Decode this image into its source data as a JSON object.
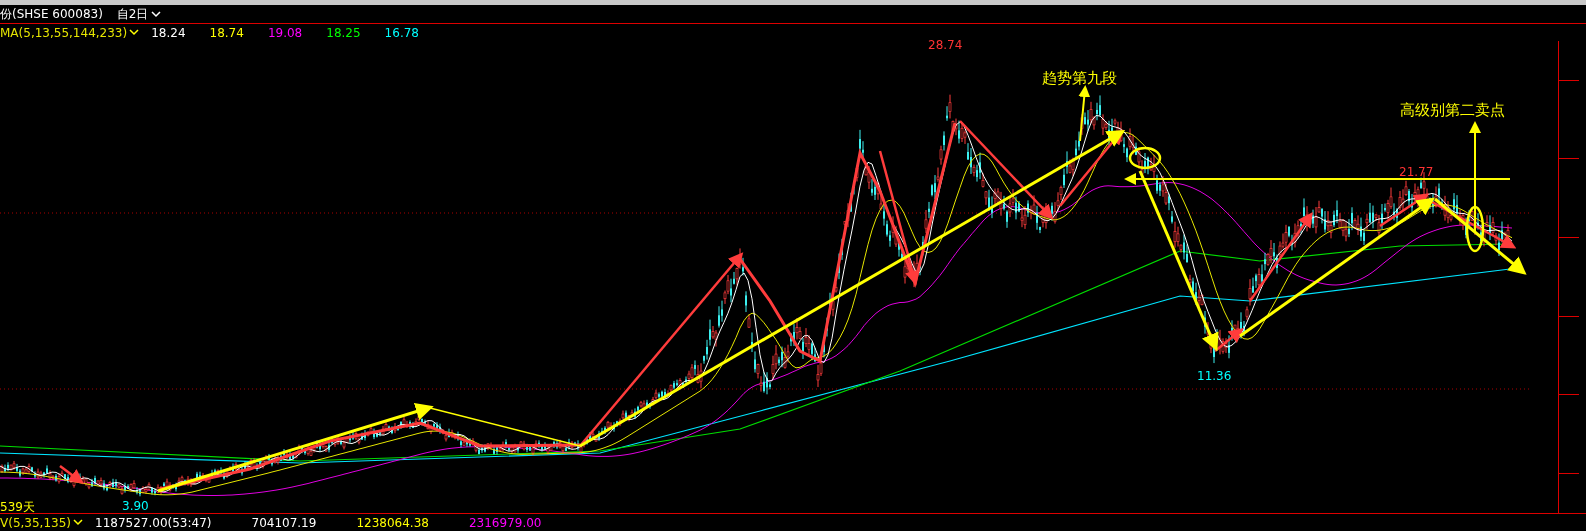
{
  "header": {
    "title": "份(SHSE 600083)",
    "period": "自2日"
  },
  "ma_legend": {
    "label": "MA(5,13,55,144,233)",
    "values": [
      {
        "value": "18.24",
        "color": "#ffffff"
      },
      {
        "value": "18.74",
        "color": "#ffff00"
      },
      {
        "value": "19.08",
        "color": "#ff00ff"
      },
      {
        "value": "18.25",
        "color": "#00ff00"
      },
      {
        "value": "16.78",
        "color": "#00ffff"
      }
    ]
  },
  "chart_labels": [
    {
      "kind": "price",
      "text": "28.74",
      "color": "#ff3333"
    },
    {
      "kind": "price",
      "text": "21.77",
      "color": "#ff3333"
    },
    {
      "kind": "price",
      "text": "11.36",
      "color": "#00ffff"
    },
    {
      "kind": "price",
      "text": "3.90",
      "color": "#00ffff"
    },
    {
      "kind": "price",
      "text": "539天",
      "color": "#ffff00"
    },
    {
      "kind": "note",
      "text": "趋势第九段",
      "color": "#ffff00"
    },
    {
      "kind": "note",
      "text": "高级别第二卖点",
      "color": "#ffff00"
    }
  ],
  "volume_legend": {
    "label": "V(5,35,135)",
    "values": [
      {
        "value": "1187527.00(53:47)",
        "color": "#ffffff"
      },
      {
        "value": "704107.19",
        "color": "#ffffff"
      },
      {
        "value": "1238064.38",
        "color": "#ffff00"
      },
      {
        "value": "2316979.00",
        "color": "#ff00ff"
      }
    ]
  }
}
